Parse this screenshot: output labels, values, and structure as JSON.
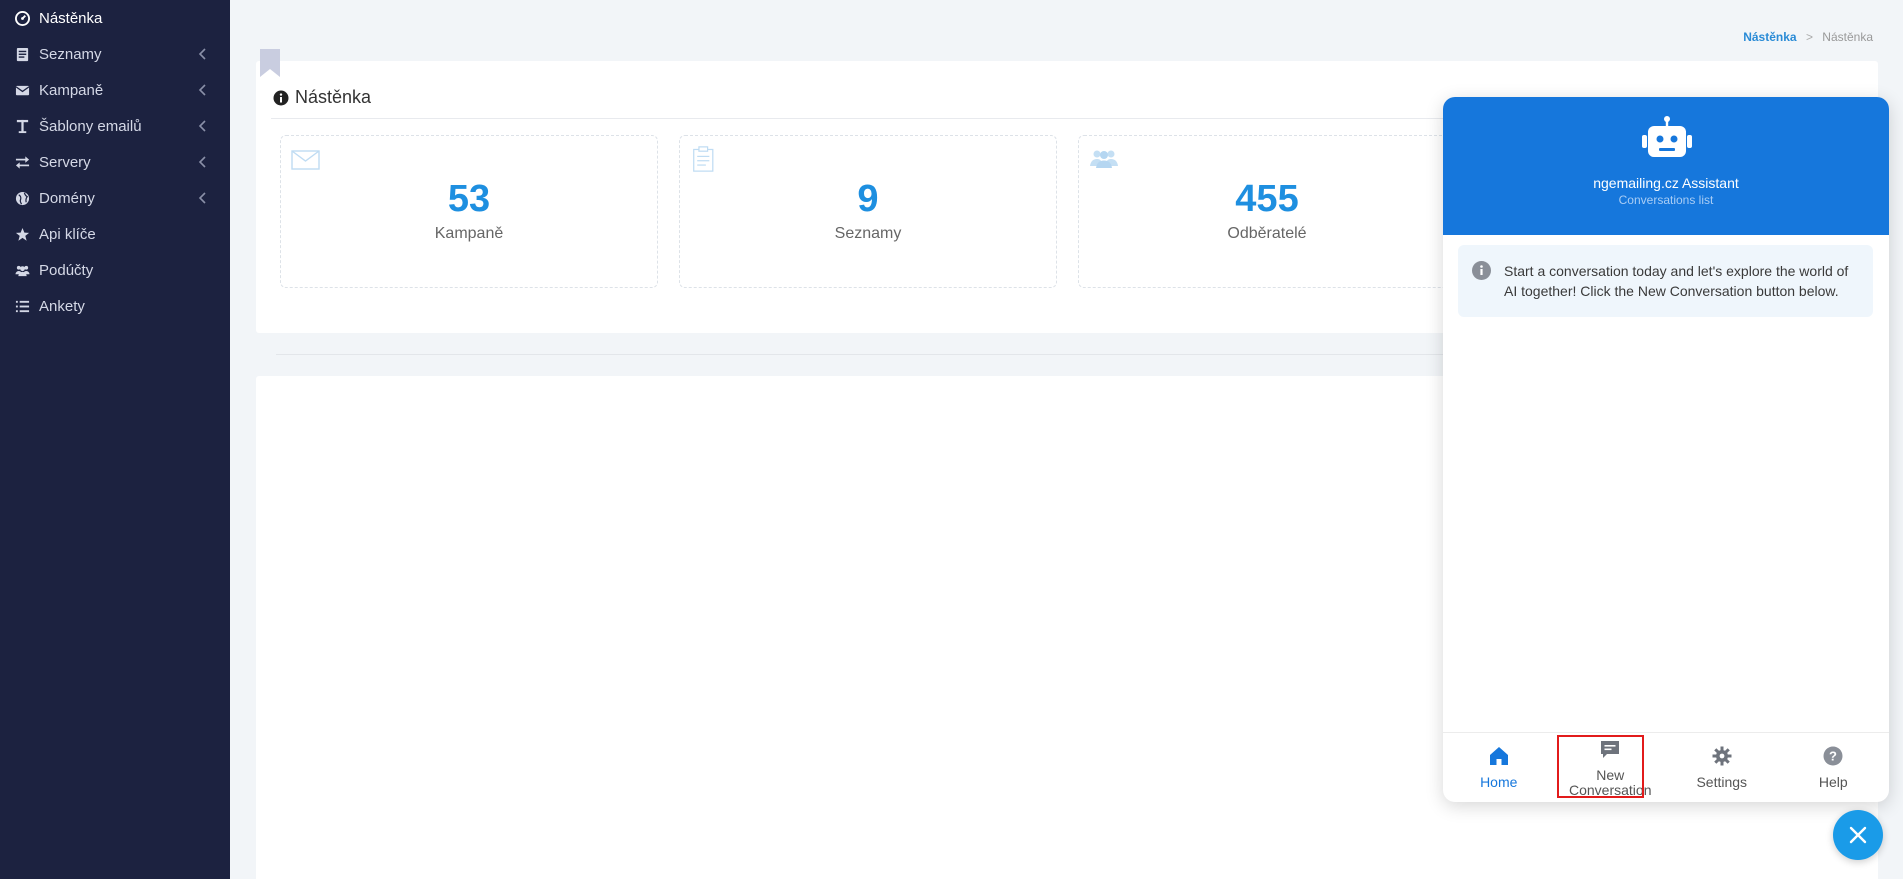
{
  "sidebar": {
    "items": [
      {
        "label": "Nástěnka",
        "icon": "dashboard-icon",
        "active": true
      },
      {
        "label": "Seznamy",
        "icon": "list-book-icon"
      },
      {
        "label": "Kampaně",
        "icon": "envelope-icon"
      },
      {
        "label": "Šablony emailů",
        "icon": "text-cursor-icon"
      },
      {
        "label": "Servery",
        "icon": "exchange-arrows-icon"
      },
      {
        "label": "Domény",
        "icon": "globe-icon"
      },
      {
        "label": "Api klíče",
        "icon": "star-icon"
      },
      {
        "label": "Podúčty",
        "icon": "users-icon"
      },
      {
        "label": "Ankety",
        "icon": "list-icon"
      }
    ]
  },
  "breadcrumb": {
    "link": "Nástěnka",
    "sep": ">",
    "current": "Nástěnka"
  },
  "panel": {
    "title": "Nástěnka"
  },
  "stats": [
    {
      "value": "53",
      "label": "Kampaně",
      "icon": "envelope-icon"
    },
    {
      "value": "9",
      "label": "Seznamy",
      "icon": "clipboard-icon"
    },
    {
      "value": "455",
      "label": "Odběratelé",
      "icon": "users-icon"
    }
  ],
  "chat": {
    "title": "ngemailing.cz Assistant",
    "subtitle": "Conversations list",
    "notice": "Start a conversation today and let's explore the world of AI together! Click the New Conversation button below.",
    "tabs": {
      "home": "Home",
      "new_line1": "New",
      "new_line2": "Conversation",
      "settings": "Settings",
      "help": "Help"
    }
  },
  "colors": {
    "sidebar_bg": "#1c2240",
    "accent": "#1677dc",
    "stat_number": "#1e8fe0",
    "highlight": "#e21b1b"
  }
}
